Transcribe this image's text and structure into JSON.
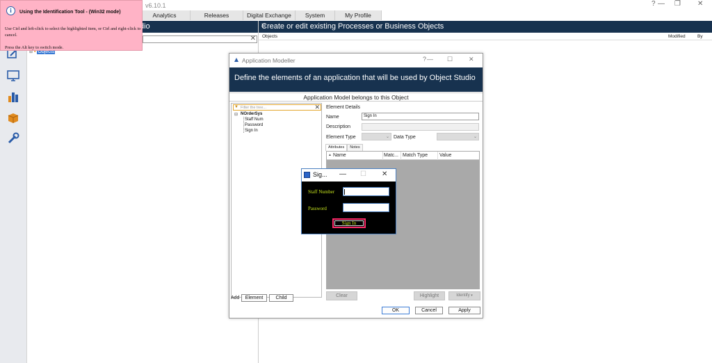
{
  "app": {
    "version": "v6.10.1",
    "window_controls": [
      "?",
      "—",
      "❐",
      "✕"
    ],
    "menu": [
      "Analytics",
      "Releases",
      "Digital Exchange",
      "System",
      "My Profile"
    ],
    "left_header_fragment": "dio",
    "left_tree_root": "Objects",
    "right_header": "Create or edit existing Processes or Business Objects",
    "right_columns": {
      "objects": "Objects",
      "modified": "Modified",
      "by": "By"
    }
  },
  "rail_icons": [
    "studio-icon",
    "control-room-icon",
    "analytics-icon",
    "releases-icon",
    "system-icon"
  ],
  "tooltip": {
    "title": "Using the Identification Tool - (Win32 mode)",
    "body": "Use Ctrl and left-click to select the highlighted item, or Ctrl and right-click to cancel.",
    "more": "Press the Alt key to switch mode."
  },
  "modeller": {
    "title": "Application Modeller",
    "banner": "Define the elements of an application that will be used by Object Studio",
    "subtitle": "Application Model belongs to this Object",
    "filter_placeholder": "Filter the tree...",
    "tree": {
      "root": "NOrderSys",
      "children": [
        "Staff Num",
        "Password",
        "Sign In"
      ]
    },
    "add_label": "Add",
    "add_element": "Element",
    "add_child": "Child",
    "details": {
      "heading": "Element Details",
      "name_label": "Name",
      "name_value": "Sign In",
      "description_label": "Description",
      "element_type_label": "Element Type",
      "data_type_label": "Data Type"
    },
    "tabs": [
      "Attributes",
      "Notes"
    ],
    "grid_columns": [
      "Name",
      "Matc...",
      "Match Type",
      "Value"
    ],
    "buttons": {
      "clear": "Clear",
      "highlight": "Highlight",
      "identify": "Identify",
      "ok": "OK",
      "cancel": "Cancel",
      "apply": "Apply"
    }
  },
  "signin": {
    "title": "Sig...",
    "staff_label": "Staff Number",
    "password_label": "Password",
    "button": "Sign In"
  },
  "colors": {
    "navy_header": "#17324f",
    "tooltip_bg": "#ffb3c6",
    "signin_text": "#c8e61e",
    "signin_highlight": "#ff2b6a"
  }
}
